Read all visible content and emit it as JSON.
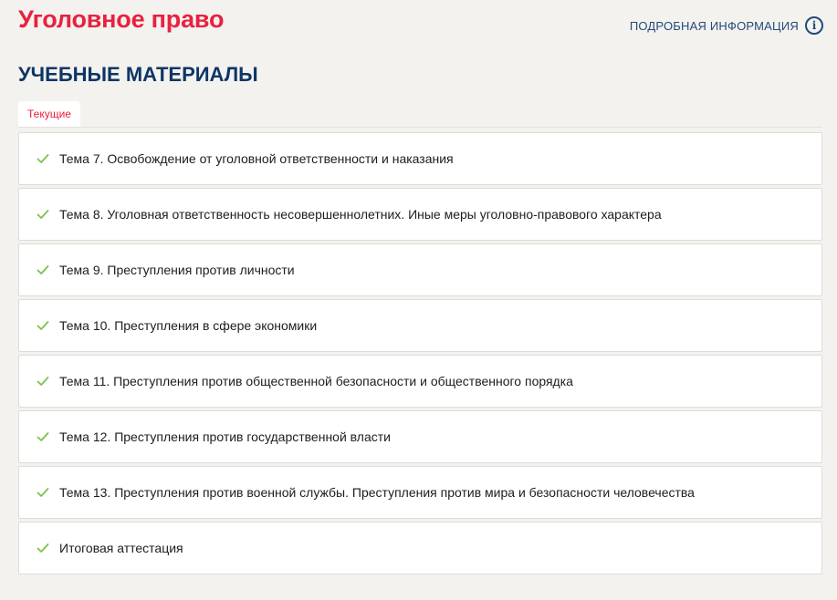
{
  "course": {
    "title": "Уголовное право",
    "info_link_label": "ПОДРОБНАЯ ИНФОРМАЦИЯ"
  },
  "materials": {
    "section_title": "УЧЕБНЫЕ МАТЕРИАЛЫ",
    "active_tab": "Текущие",
    "topics": [
      {
        "label": "Тема 7. Освобождение от уголовной ответственности и наказания",
        "completed": true
      },
      {
        "label": "Тема 8. Уголовная ответственность несовершеннолетних. Иные меры уголовно-правового характера",
        "completed": true
      },
      {
        "label": "Тема 9. Преступления против личности",
        "completed": true
      },
      {
        "label": "Тема 10. Преступления в сфере экономики",
        "completed": true
      },
      {
        "label": "Тема 11. Преступления против общественной безопасности и общественного порядка",
        "completed": true
      },
      {
        "label": "Тема 12. Преступления против государственной власти",
        "completed": true
      },
      {
        "label": "Тема 13. Преступления против военной службы. Преступления против мира и безопасности человечества",
        "completed": true
      },
      {
        "label": "Итоговая аттестация",
        "completed": true
      }
    ]
  },
  "icons": {
    "info": "info-circle-icon",
    "check": "check-icon"
  },
  "colors": {
    "title_red": "#e8213f",
    "navy": "#0e3565",
    "link_blue": "#234a78",
    "check_green": "#7cc24c",
    "background": "#f3f2ef"
  }
}
